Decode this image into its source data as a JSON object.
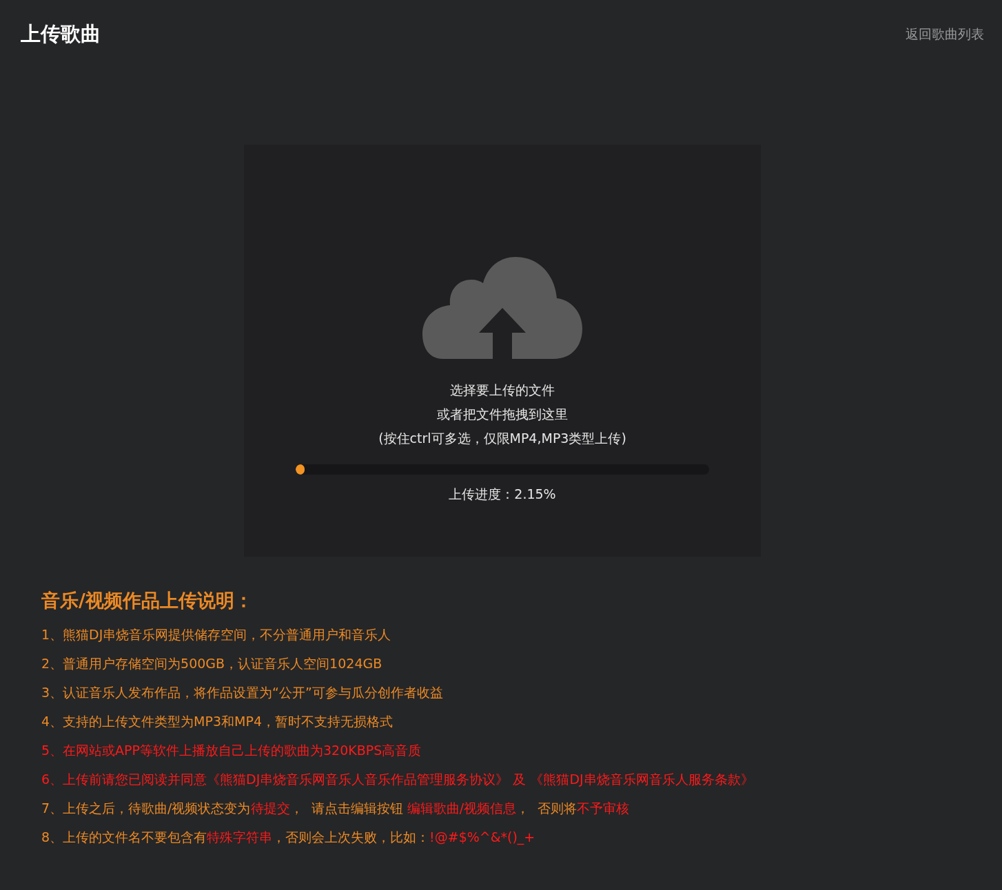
{
  "header": {
    "title": "上传歌曲",
    "back_link": "返回歌曲列表"
  },
  "upload": {
    "lines": [
      "选择要上传的文件",
      "或者把文件拖拽到这里",
      "(按住ctrl可多选，仅限MP4,MP3类型上传)"
    ],
    "progress": {
      "level": 0.0215,
      "reading": "上传进度：2.15%"
    }
  },
  "notes": {
    "title": "音乐/视频作品上传说明：",
    "items": [
      {
        "segments": [
          {
            "text": "1、熊猫DJ串烧音乐网提供储存空间，不分普通用户和音乐人",
            "highlight": false
          }
        ]
      },
      {
        "segments": [
          {
            "text": "2、普通用户存储空间为500GB，认证音乐人空间1024GB",
            "highlight": false
          }
        ]
      },
      {
        "segments": [
          {
            "text": "3、认证音乐人发布作品，将作品设置为“公开”可参与瓜分创作者收益",
            "highlight": false
          }
        ]
      },
      {
        "segments": [
          {
            "text": "4、支持的上传文件类型为MP3和MP4，暂时不支持无损格式",
            "highlight": false
          }
        ]
      },
      {
        "segments": [
          {
            "text": "5、在网站或APP等软件上播放自己上传的歌曲为320KBPS高音质",
            "highlight": true
          }
        ]
      },
      {
        "segments": [
          {
            "text": "6、上传前请您已阅读并同意《熊猫DJ串烧音乐网音乐人音乐作品管理服务协议》 及 《熊猫DJ串烧音乐网音乐人服务条款》",
            "highlight": true
          }
        ]
      },
      {
        "segments": [
          {
            "text": "7、上传之后，待歌曲/视频状态变为",
            "highlight": false
          },
          {
            "text": "待提交",
            "highlight": true
          },
          {
            "text": "，  请点击编辑按钮 ",
            "highlight": false
          },
          {
            "text": "编辑歌曲/视频信息",
            "highlight": true
          },
          {
            "text": "，  否则将",
            "highlight": false
          },
          {
            "text": "不予审核",
            "highlight": true
          }
        ]
      },
      {
        "segments": [
          {
            "text": "8、上传的文件名不要包含有",
            "highlight": false
          },
          {
            "text": "特殊字符串",
            "highlight": true
          },
          {
            "text": "，否则会上次失败，比如：",
            "highlight": false
          },
          {
            "text": "!@#$%^&*()_+",
            "highlight": true
          }
        ]
      }
    ]
  }
}
